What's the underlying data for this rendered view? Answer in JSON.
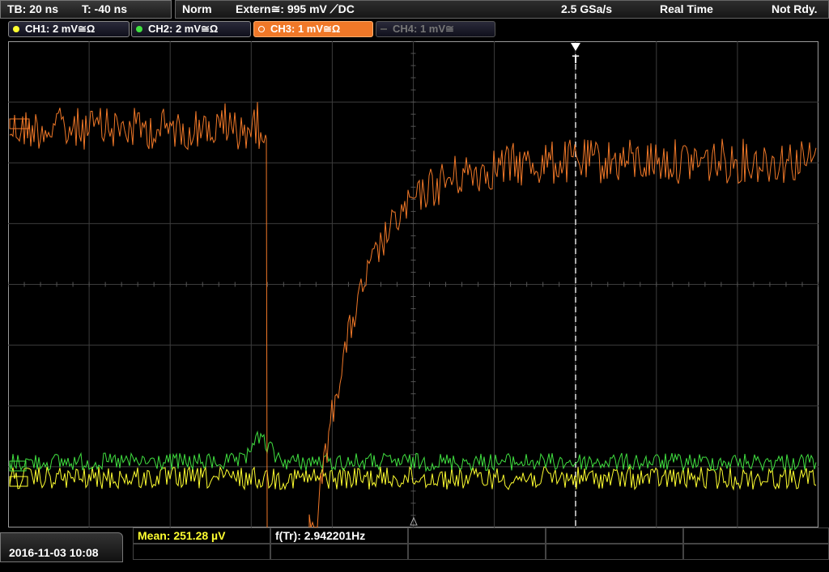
{
  "timebase": {
    "tb": "TB: 20 ns",
    "trigger_time": "T: -40 ns"
  },
  "status": {
    "mode": "Norm",
    "trigger": "Extern≅: 995 mV ⟋DC",
    "sample_rate": "2.5 GSa/s",
    "acq_mode": "Real Time",
    "state": "Not Rdy."
  },
  "channels": [
    {
      "label": "CH1: 2 mV≅Ω",
      "color": "#ffff30",
      "state": "on"
    },
    {
      "label": "CH2: 2 mV≅Ω",
      "color": "#40e040",
      "state": "on"
    },
    {
      "label": "CH3: 1 mV≅Ω",
      "color": "#f07828",
      "state": "active"
    },
    {
      "label": "CH4: 1 mV≅",
      "color": "#777777",
      "state": "off"
    }
  ],
  "trigger_marker": "T",
  "footer": {
    "datetime": "2016-11-03 10:08",
    "mean": "Mean: 251.28 µV",
    "freq": "f(Tr): 2.942201Hz"
  },
  "colors": {
    "ch1": "#ffff30",
    "ch2": "#40e040",
    "ch3": "#f07828",
    "grid": "#3c3c3c"
  }
}
